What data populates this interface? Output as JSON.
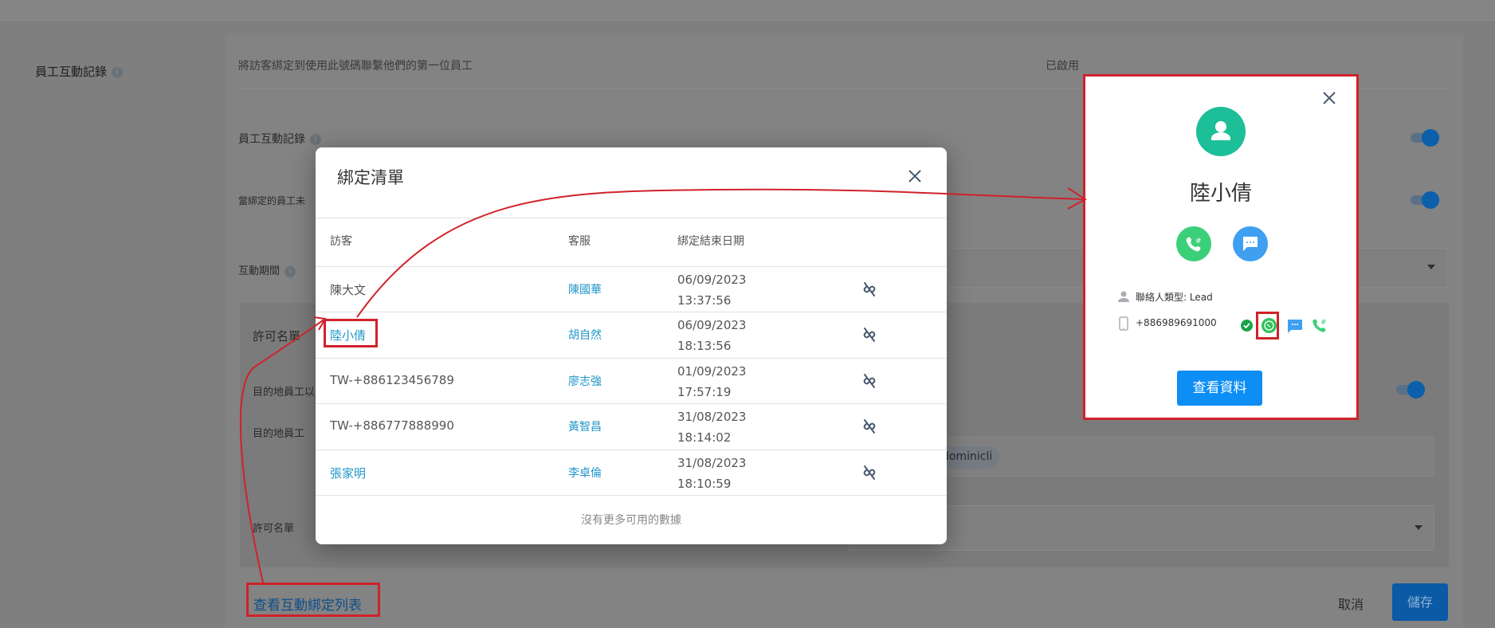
{
  "background": {
    "section_label": "員工互動記錄",
    "bind_description": "將訪客綁定到使用此號碼聯繫他們的第一位員工",
    "bind_status": "已啟用",
    "interaction_log_label": "員工互動記錄",
    "unavailable_label": "當綁定的員工未",
    "period_label": "互動期間",
    "allowlist_title": "許可名單",
    "dest_staff_toggle_label": "目的地員工以",
    "dest_staff_label": "目的地員工",
    "dest_staff_chip": "dominicli",
    "allowlist_label": "許可名單",
    "view_binding_list_link": "查看互動綁定列表",
    "cancel_label": "取消",
    "save_label": "儲存"
  },
  "modal": {
    "title": "綁定清單",
    "columns": [
      "訪客",
      "客服",
      "綁定結束日期"
    ],
    "rows": [
      {
        "visitor": "陳大文",
        "visitor_link": false,
        "agent": "陳國華",
        "date": "06/09/2023",
        "time": "13:37:56"
      },
      {
        "visitor": "陸小倩",
        "visitor_link": true,
        "agent": "胡自然",
        "date": "06/09/2023",
        "time": "18:13:56"
      },
      {
        "visitor": "TW-+886123456789",
        "visitor_link": false,
        "agent": "廖志強",
        "date": "01/09/2023",
        "time": "17:57:19"
      },
      {
        "visitor": "TW-+886777888990",
        "visitor_link": false,
        "agent": "黃智昌",
        "date": "31/08/2023",
        "time": "18:14:02"
      },
      {
        "visitor": "張家明",
        "visitor_link": true,
        "agent": "李卓倫",
        "date": "31/08/2023",
        "time": "18:10:59"
      }
    ],
    "footer": "沒有更多可用的數據"
  },
  "contact_card": {
    "name": "陸小倩",
    "contact_type_label": "聯絡人類型:",
    "contact_type": "Lead",
    "phone": "+886989691000",
    "view_button": "查看資料"
  },
  "colors": {
    "annotation_red": "#d0222a",
    "link_blue": "#2196c9",
    "avatar_teal": "#1dbf98",
    "call_green": "#3ccf7a",
    "message_blue": "#3f9ff0",
    "primary_button": "#0d8ef5"
  }
}
